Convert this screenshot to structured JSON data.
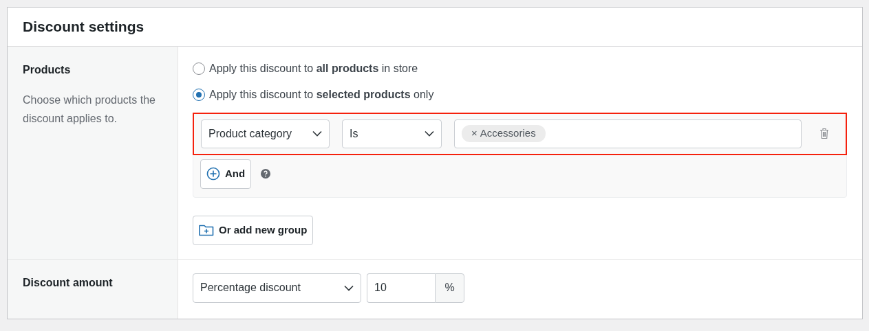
{
  "card": {
    "title": "Discount settings"
  },
  "products": {
    "label": "Products",
    "description": "Choose which products the discount applies to.",
    "options": [
      {
        "label": "Apply this discount to **all products** in store",
        "selected": false
      },
      {
        "label": "Apply this discount to **selected products** only",
        "selected": true
      }
    ],
    "condition": {
      "highlighted": true,
      "field": "Product category",
      "operator": "Is",
      "tags": [
        {
          "remove": "×",
          "label": "Accessories"
        }
      ],
      "and_button": "And"
    },
    "group_button": "Or add new group"
  },
  "amount": {
    "label": "Discount amount",
    "type": "Percentage discount",
    "value": "10",
    "unit": "%"
  }
}
